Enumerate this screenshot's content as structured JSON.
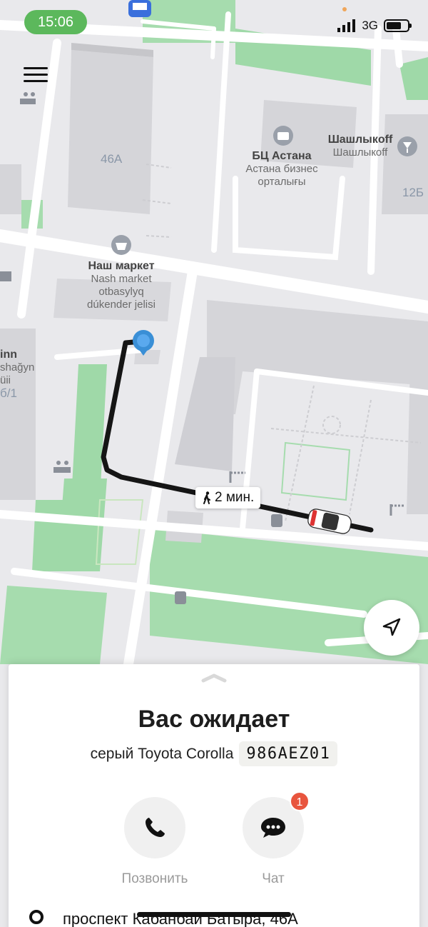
{
  "status_bar": {
    "time": "15:06",
    "network": "3G"
  },
  "map": {
    "labels": {
      "building_46a": "46А",
      "building_12b": "12Б",
      "bc_astana_name": "БЦ Астана",
      "bc_astana_sub1": "Астана бизнес",
      "bc_astana_sub2": "орталығы",
      "shashlykoff_name": "Шашлыкoff",
      "shashlykoff_sub": "Шашлыкoff",
      "nash_market_name": "Наш маркет",
      "nash_market_sub1": "Nash market",
      "nash_market_sub2": "otbasylyq",
      "nash_market_sub3": "dúkender jelisi",
      "left_inn": "inn",
      "left_sub1": "shağyn",
      "left_sub2": "üii",
      "left_num": "б/1"
    },
    "eta_label": "2 мин."
  },
  "sheet": {
    "title": "Вас ожидает",
    "car_description": "серый Toyota Corolla",
    "plate": "986AEZ01",
    "call_label": "Позвонить",
    "chat_label": "Чат",
    "chat_badge": "1",
    "address": "проспект Кабанбай Батыра, 46А"
  },
  "colors": {
    "route": "#111111",
    "status_pill": "#5cb85c",
    "badge": "#e8553e",
    "park": "#8fd39b",
    "pin": "#3a8fd6"
  }
}
